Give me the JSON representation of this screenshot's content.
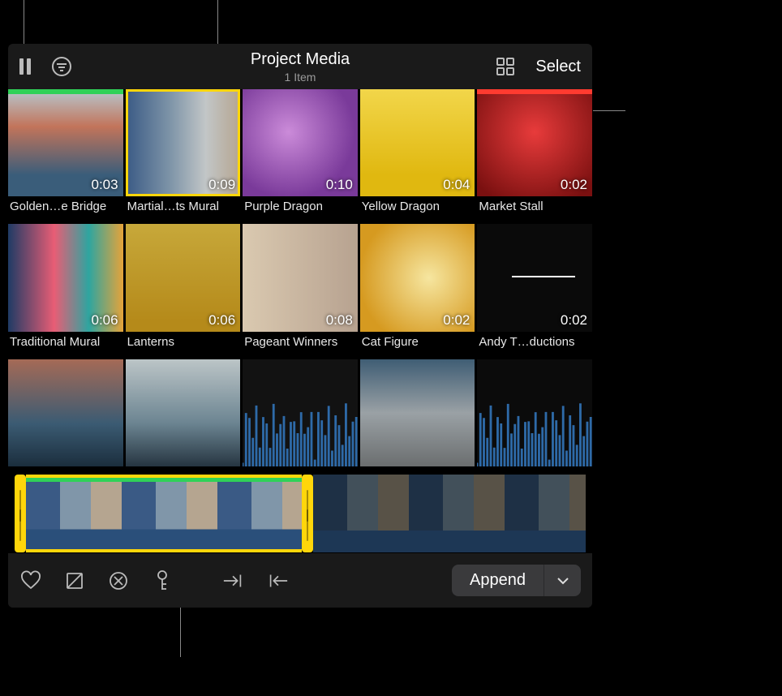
{
  "header": {
    "title": "Project Media",
    "subtitle": "1 Item",
    "select_label": "Select"
  },
  "media": {
    "rows": [
      [
        {
          "label": "Golden…e Bridge",
          "duration": "0:03",
          "selected": false,
          "usage": 100,
          "usageColor": "green",
          "bg": "t1"
        },
        {
          "label": "Martial…ts Mural",
          "duration": "0:09",
          "selected": true,
          "usage": 0,
          "bg": "t2"
        },
        {
          "label": "Purple Dragon",
          "duration": "0:10",
          "selected": false,
          "usage": 0,
          "bg": "t3"
        },
        {
          "label": "Yellow Dragon",
          "duration": "0:04",
          "selected": false,
          "usage": 0,
          "bg": "t4"
        },
        {
          "label": "Market Stall",
          "duration": "0:02",
          "selected": false,
          "usage": 100,
          "usageColor": "red",
          "bg": "t5"
        }
      ],
      [
        {
          "label": "Traditional Mural",
          "duration": "0:06",
          "selected": false,
          "usage": 0,
          "bg": "t6"
        },
        {
          "label": "Lanterns",
          "duration": "0:06",
          "selected": false,
          "usage": 0,
          "bg": "t7"
        },
        {
          "label": "Pageant Winners",
          "duration": "0:08",
          "selected": false,
          "usage": 0,
          "bg": "t8"
        },
        {
          "label": "Cat Figure",
          "duration": "0:02",
          "selected": false,
          "usage": 0,
          "bg": "t9"
        },
        {
          "label": "Andy T…ductions",
          "duration": "0:02",
          "selected": false,
          "usage": 0,
          "bg": "t10"
        }
      ],
      [
        {
          "label": "",
          "duration": "",
          "selected": false,
          "usage": 0,
          "bg": "t11",
          "noCaption": true
        },
        {
          "label": "",
          "duration": "",
          "selected": false,
          "usage": 0,
          "bg": "t12",
          "noCaption": true
        },
        {
          "label": "",
          "duration": "",
          "selected": false,
          "usage": 0,
          "bg": "t13",
          "noCaption": true,
          "wave": true
        },
        {
          "label": "",
          "duration": "",
          "selected": false,
          "usage": 0,
          "bg": "t14",
          "noCaption": true
        },
        {
          "label": "",
          "duration": "",
          "selected": false,
          "usage": 0,
          "bg": "t15",
          "noCaption": true,
          "wave": true
        }
      ]
    ]
  },
  "toolbar": {
    "append_label": "Append"
  },
  "icons": {
    "pause": "pause-icon",
    "filter": "filter-icon",
    "grid": "grid-view-icon",
    "favorite": "heart-icon",
    "reject": "reject-icon",
    "unrate": "clear-rating-icon",
    "keyword": "keyword-icon",
    "mark_in": "mark-in-icon",
    "mark_out": "mark-out-icon",
    "chevron": "chevron-down-icon"
  }
}
